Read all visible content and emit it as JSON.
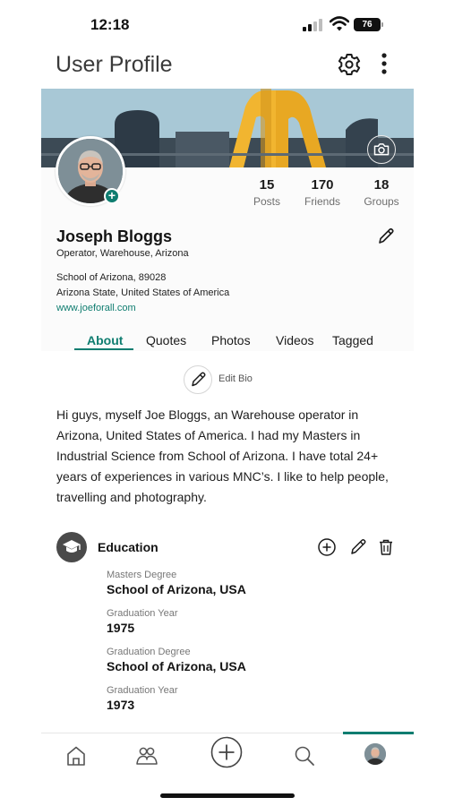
{
  "status_bar": {
    "time": "12:18",
    "battery": "76"
  },
  "header": {
    "title": "User Profile",
    "settings_icon": "gear-icon",
    "more_icon": "more-vertical-icon"
  },
  "profile": {
    "name": "Joseph Bloggs",
    "role": "Operator, Warehouse, Arizona",
    "address_line1": "School of Arizona, 89028",
    "address_line2": "Arizona State, United States of America",
    "website": "www.joeforall.com",
    "stats": [
      {
        "value": "15",
        "label": "Posts"
      },
      {
        "value": "170",
        "label": "Friends"
      },
      {
        "value": "18",
        "label": "Groups"
      }
    ]
  },
  "tabs": [
    {
      "label": "About",
      "active": true
    },
    {
      "label": "Quotes",
      "active": false
    },
    {
      "label": "Photos",
      "active": false
    },
    {
      "label": "Videos",
      "active": false
    },
    {
      "label": "Tagged",
      "active": false
    }
  ],
  "about": {
    "edit_bio_label": "Edit Bio",
    "bio": "Hi guys, myself Joe Bloggs, an Warehouse operator in Arizona, United States of America. I had my Masters in Industrial Science from School of Arizona. I have total 24+ years of experiences in various MNC’s. I like to help people, travelling and photography."
  },
  "education": {
    "title": "Education",
    "entries": [
      {
        "label": "Masters Degree",
        "value": "School of Arizona, USA"
      },
      {
        "label": "Graduation Year",
        "value": "1975"
      },
      {
        "label": "Graduation Degree",
        "value": "School of Arizona, USA"
      },
      {
        "label": "Graduation Year",
        "value": "1973"
      }
    ]
  },
  "bottom_nav": {
    "items": [
      "home-icon",
      "people-icon",
      "add-circle-icon",
      "search-icon",
      "profile-avatar"
    ],
    "active": "profile-avatar"
  },
  "colors": {
    "accent": "#0f7d70"
  }
}
